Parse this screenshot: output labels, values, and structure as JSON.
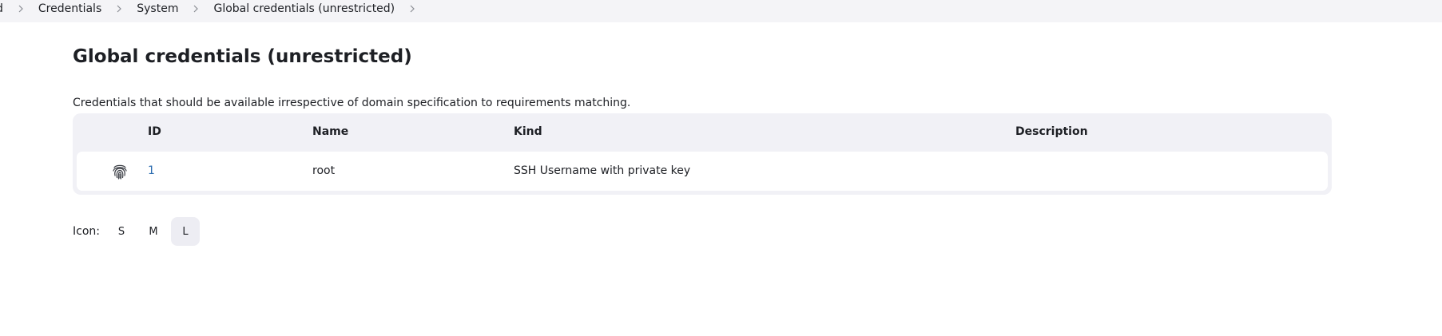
{
  "breadcrumb": {
    "partial_first": "d",
    "items": [
      "Credentials",
      "System",
      "Global credentials (unrestricted)"
    ]
  },
  "page": {
    "title": "Global credentials (unrestricted)",
    "description": "Credentials that should be available irrespective of domain specification to requirements matching."
  },
  "table": {
    "headers": {
      "id": "ID",
      "name": "Name",
      "kind": "Kind",
      "description": "Description"
    },
    "rows": [
      {
        "icon": "fingerprint-icon",
        "id": "1",
        "name": "root",
        "kind": "SSH Username with private key",
        "description": ""
      }
    ]
  },
  "icon_size": {
    "label": "Icon:",
    "options": [
      "S",
      "M",
      "L"
    ],
    "selected": "L"
  },
  "colors": {
    "link": "#2b6cb0",
    "table_bg": "#f1f1f6",
    "breadcrumb_bg": "#f4f4f7"
  }
}
